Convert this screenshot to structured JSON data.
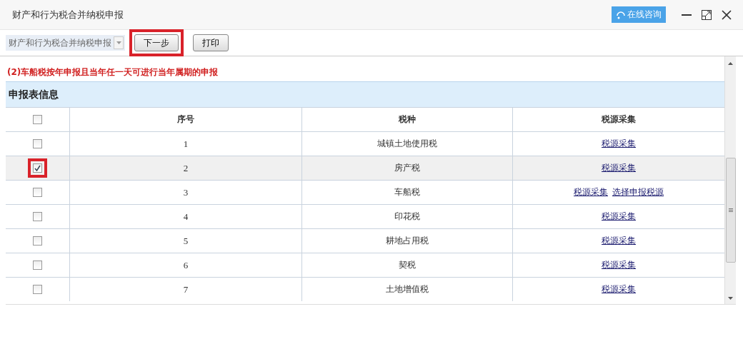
{
  "window": {
    "title": "财产和行为税合并纳税申报",
    "consult_button": "在线咨询"
  },
  "toolbar": {
    "dropdown": {
      "value": "财产和行为税合并纳税申报"
    },
    "buttons": [
      {
        "label": "下一步",
        "highlighted": true
      },
      {
        "label": "打印",
        "highlighted": false
      }
    ]
  },
  "notice": "(2)车船税按年申报且当年任一天可进行当年属期的申报",
  "section_title": "申报表信息",
  "table": {
    "header_checked": false,
    "columns": [
      "序号",
      "税种",
      "税源采集"
    ],
    "rows": [
      {
        "checked": false,
        "highlighted": false,
        "no": "1",
        "tax": "城镇土地使用税",
        "links": [
          "税源采集"
        ]
      },
      {
        "checked": true,
        "highlighted": true,
        "no": "2",
        "tax": "房产税",
        "links": [
          "税源采集"
        ]
      },
      {
        "checked": false,
        "highlighted": false,
        "no": "3",
        "tax": "车船税",
        "links": [
          "税源采集",
          "选择申报税源"
        ]
      },
      {
        "checked": false,
        "highlighted": false,
        "no": "4",
        "tax": "印花税",
        "links": [
          "税源采集"
        ]
      },
      {
        "checked": false,
        "highlighted": false,
        "no": "5",
        "tax": "耕地占用税",
        "links": [
          "税源采集"
        ]
      },
      {
        "checked": false,
        "highlighted": false,
        "no": "6",
        "tax": "契税",
        "links": [
          "税源采集"
        ]
      },
      {
        "checked": false,
        "highlighted": false,
        "no": "7",
        "tax": "土地增值税",
        "links": [
          "税源采集"
        ]
      }
    ]
  }
}
